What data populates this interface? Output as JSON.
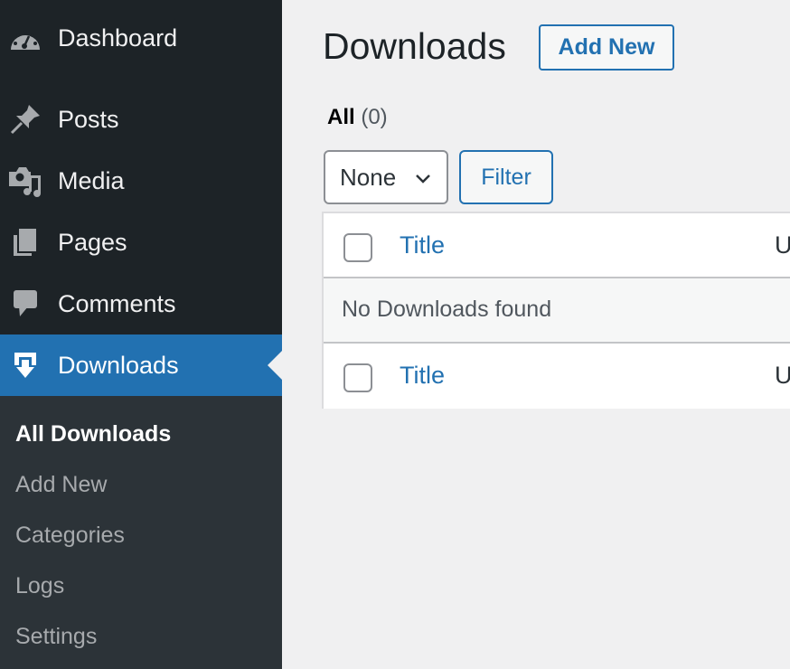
{
  "sidebar": {
    "items": [
      {
        "label": "Dashboard",
        "icon": "dashboard-icon"
      },
      {
        "label": "Posts",
        "icon": "pin-icon"
      },
      {
        "label": "Media",
        "icon": "media-icon"
      },
      {
        "label": "Pages",
        "icon": "pages-icon"
      },
      {
        "label": "Comments",
        "icon": "comment-icon"
      },
      {
        "label": "Downloads",
        "icon": "download-icon",
        "active": true
      }
    ],
    "submenu": [
      {
        "label": "All Downloads",
        "current": true
      },
      {
        "label": "Add New"
      },
      {
        "label": "Categories"
      },
      {
        "label": "Logs"
      },
      {
        "label": "Settings"
      }
    ]
  },
  "main": {
    "title": "Downloads",
    "add_new_label": "Add New",
    "views": {
      "all_label": "All",
      "all_count": "(0)"
    },
    "filter_select": {
      "value": "None"
    },
    "filter_label": "Filter",
    "table": {
      "columns": [
        "Title",
        "U"
      ],
      "empty_message": "No Downloads found"
    }
  },
  "colors": {
    "accent": "#2271b1",
    "sidebar_bg": "#1d2327",
    "submenu_bg": "#2c3338"
  }
}
